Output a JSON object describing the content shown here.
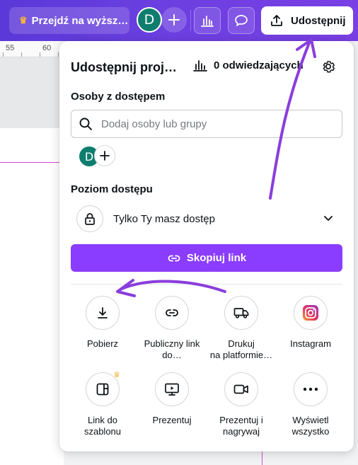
{
  "topbar": {
    "upgrade_label": "Przejdź na wyższ…",
    "avatar_letter": "D",
    "share_label": "Udostępnij"
  },
  "ruler": {
    "marks": [
      "55",
      "60"
    ]
  },
  "panel": {
    "title": "Udostępnij proj…",
    "visitors_label": "0 odwiedzających",
    "people_section_label": "Osoby z dostępem",
    "search_placeholder": "Dodaj osoby lub grupy",
    "person_avatar_letter": "D",
    "access_section_label": "Poziom dostępu",
    "access_value": "Tylko Ty masz dostęp",
    "copy_link_label": "Skopiuj link",
    "options": [
      {
        "line1": "Pobierz",
        "line2": "",
        "icon": "download-icon"
      },
      {
        "line1": "Publiczny link",
        "line2": "do…",
        "icon": "link-icon"
      },
      {
        "line1": "Drukuj",
        "line2": "na platformie…",
        "icon": "truck-icon"
      },
      {
        "line1": "Instagram",
        "line2": "",
        "icon": "instagram-icon"
      },
      {
        "line1": "Link do",
        "line2": "szablonu",
        "icon": "template-icon"
      },
      {
        "line1": "Prezentuj",
        "line2": "",
        "icon": "present-icon"
      },
      {
        "line1": "Prezentuj i",
        "line2": "nagrywaj",
        "icon": "record-icon"
      },
      {
        "line1": "Wyświetl",
        "line2": "wszystko",
        "icon": "more-icon"
      }
    ]
  },
  "colors": {
    "brand_purple": "#8b3dff",
    "avatar_green": "#0f7d6e",
    "crown_gold": "#f5b63a",
    "annotation_purple": "#8a3ddc"
  }
}
